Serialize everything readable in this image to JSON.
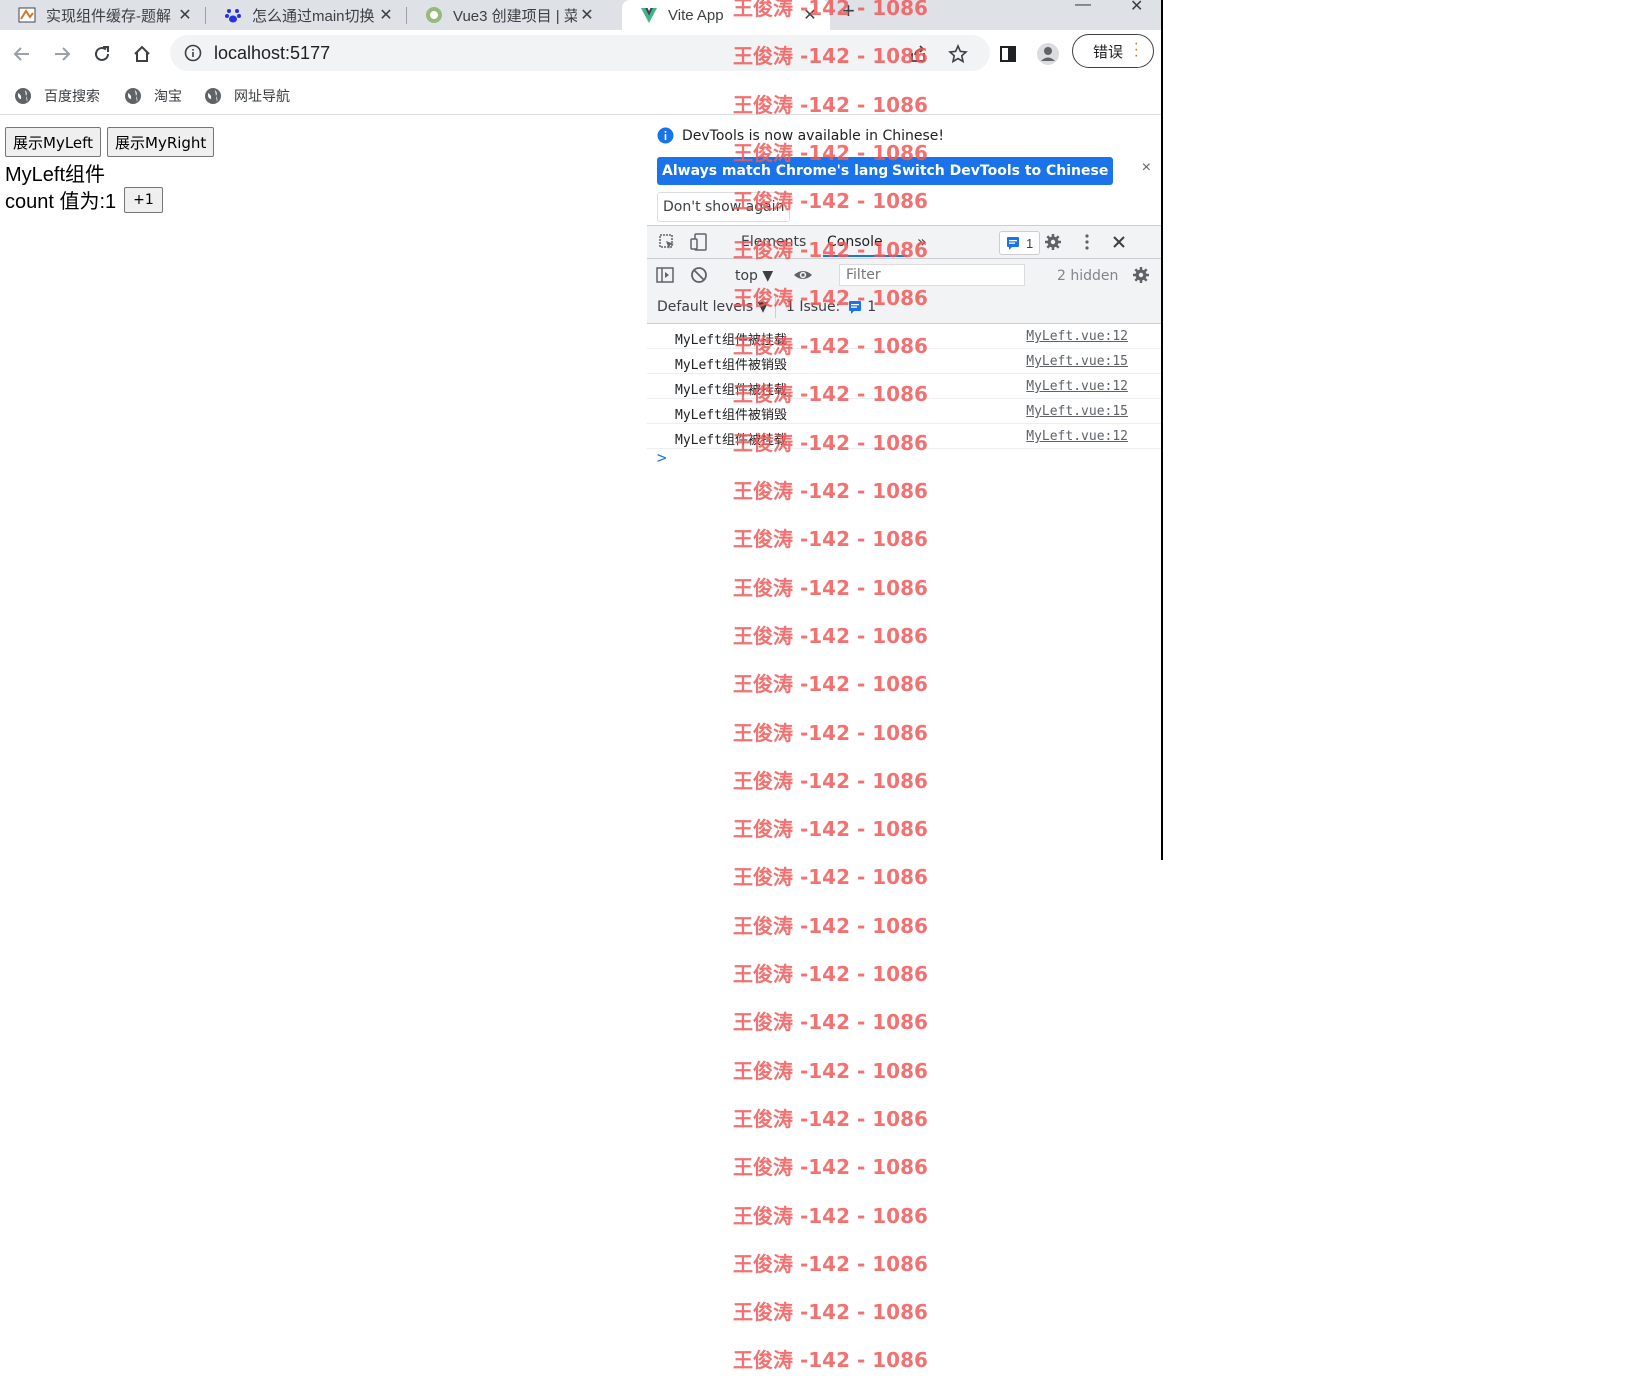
{
  "tabs": [
    {
      "title": "实现组件缓存-题解",
      "favicon": "scratch-icon"
    },
    {
      "title": "怎么通过main切换",
      "favicon": "baidu-paw-icon"
    },
    {
      "title": "Vue3 创建项目 | 菜",
      "favicon": "runoob-icon"
    },
    {
      "title": "Vite App",
      "favicon": "vite-icon",
      "active": true
    }
  ],
  "toolbar": {
    "url": "localhost:5177",
    "profile_label": "错误"
  },
  "bookmarks": [
    {
      "label": "百度搜索"
    },
    {
      "label": "淘宝"
    },
    {
      "label": "网址导航"
    }
  ],
  "page": {
    "show_left_label": "展示MyLeft",
    "show_right_label": "展示MyRight",
    "component_title": "MyLeft组件",
    "count_text": "count 值为:1",
    "increment_label": "+1"
  },
  "devtools": {
    "banner": {
      "message": "DevTools is now available in Chinese!",
      "match_language_label": "Always match Chrome's language",
      "switch_label": "Switch DevTools to Chinese",
      "dont_show_label": "Don't show again",
      "close": "×"
    },
    "tabs": {
      "elements": "Elements",
      "console": "Console",
      "more": "»",
      "issues_count": "1"
    },
    "console_bar": {
      "context": "top ▼",
      "filter_placeholder": "Filter",
      "hidden": "2 hidden"
    },
    "levels_bar": {
      "levels": "Default levels ▼",
      "issue_label": "1 Issue:",
      "issue_count": "1"
    },
    "messages": [
      {
        "text": "MyLeft组件被挂载",
        "source": "MyLeft.vue:12"
      },
      {
        "text": "MyLeft组件被销毁",
        "source": "MyLeft.vue:15"
      },
      {
        "text": "MyLeft组件被挂载",
        "source": "MyLeft.vue:12"
      },
      {
        "text": "MyLeft组件被销毁",
        "source": "MyLeft.vue:15"
      },
      {
        "text": "MyLeft组件被挂载",
        "source": "MyLeft.vue:12"
      }
    ],
    "prompt": ">"
  },
  "watermark": {
    "text": "王俊涛 -142 - 1086",
    "color": "#f05a5a"
  }
}
